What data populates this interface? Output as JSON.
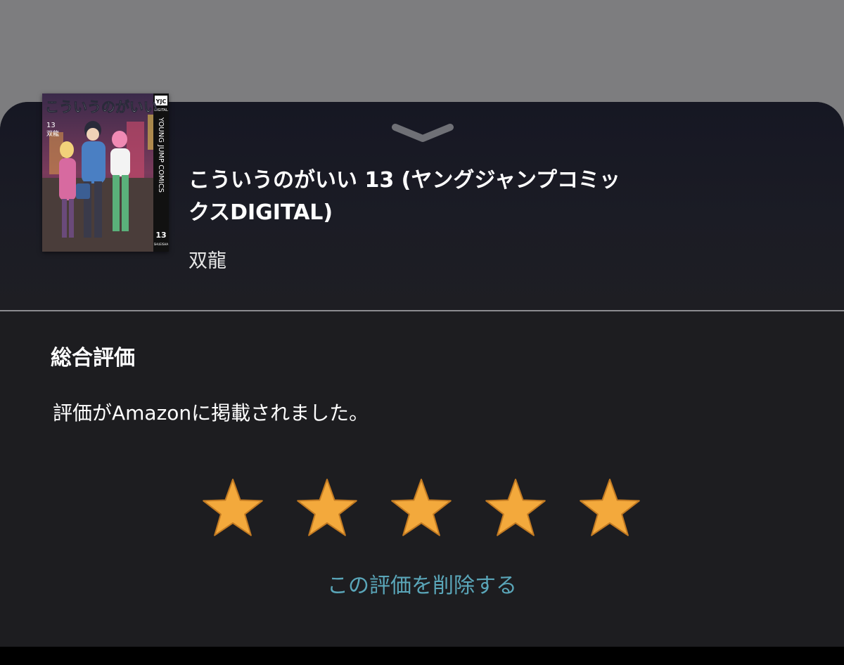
{
  "book": {
    "title": "こういうのがいい 13 (ヤングジャンプコミックスDIGITAL)",
    "author": "双龍",
    "cover": {
      "title_text": "こういうのがいい",
      "volume": "13",
      "author": "双龍",
      "publisher_badge": "YJC",
      "publisher_badge_sub": "DIGITAL",
      "spine_text": "YOUNG JUMP COMICS",
      "spine_volume": "13",
      "spine_publisher": "SHUEISHA"
    }
  },
  "rating": {
    "heading": "総合評価",
    "status": "評価がAmazonに掲載されました。",
    "stars": 5,
    "max_stars": 5,
    "star_color": "#f3a93c",
    "star_outline_color": "#c27a22",
    "delete_label": "この評価を削除する",
    "delete_color": "#5aa6b9"
  },
  "icons": {
    "collapse": "chevron-down-icon",
    "star": "star-icon"
  }
}
